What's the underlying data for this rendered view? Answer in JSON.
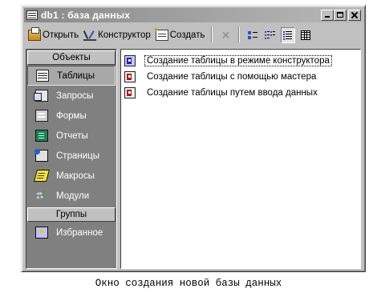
{
  "window": {
    "title": "db1 : база данных",
    "title_icon": "database-icon",
    "buttons": [
      "minimize",
      "maximize",
      "close"
    ]
  },
  "toolbar": {
    "open_label": "Открыть",
    "design_label": "Конструктор",
    "create_label": "Создать",
    "view_icons": [
      "large-icons-icon",
      "small-icons-icon",
      "list-view-icon",
      "details-view-icon"
    ],
    "pressed_view": "list-view-icon"
  },
  "sidebar": {
    "objects_header": "Объекты",
    "items": [
      {
        "label": "Таблицы",
        "icon": "table-icon",
        "selected": true
      },
      {
        "label": "Запросы",
        "icon": "query-icon"
      },
      {
        "label": "Формы",
        "icon": "form-icon"
      },
      {
        "label": "Отчеты",
        "icon": "report-icon"
      },
      {
        "label": "Страницы",
        "icon": "page-icon"
      },
      {
        "label": "Макросы",
        "icon": "macro-icon"
      },
      {
        "label": "Модули",
        "icon": "module-icon"
      }
    ],
    "groups_header": "Группы",
    "groups": [
      {
        "label": "Избранное",
        "icon": "favorites-icon"
      }
    ]
  },
  "list": {
    "items": [
      {
        "label": "Создание таблицы в режиме конструктора",
        "focused": true
      },
      {
        "label": "Создание таблицы с помощью мастера"
      },
      {
        "label": "Создание таблицы путем ввода данных"
      }
    ]
  },
  "caption": "Окно создания новой базы данных"
}
